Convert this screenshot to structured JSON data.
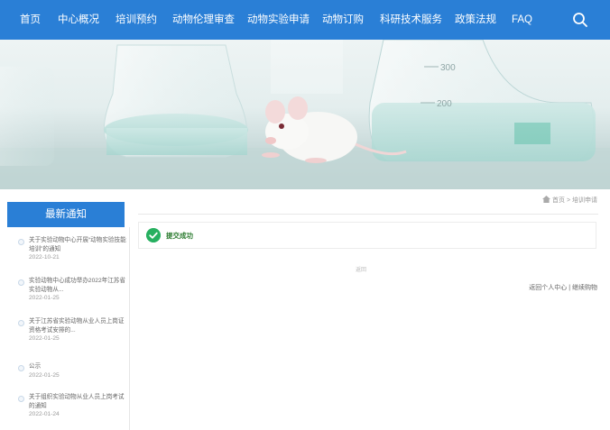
{
  "nav": {
    "items": [
      {
        "label": "首页"
      },
      {
        "label": "中心概况"
      },
      {
        "label": "培训预约"
      },
      {
        "label": "动物伦理审查"
      },
      {
        "label": "动物实验申请"
      },
      {
        "label": "动物订购"
      },
      {
        "label": "科研技术服务"
      },
      {
        "label": "政策法规"
      },
      {
        "label": "FAQ"
      }
    ],
    "search_icon": "search-icon"
  },
  "banner": {
    "flask_markings": [
      "300",
      "200"
    ]
  },
  "sidebar": {
    "title": "最新通知",
    "notices": [
      {
        "title": "关于实验动物中心开展“动物实验技能培训”的通知",
        "date": "2022-10-21"
      },
      {
        "title": "实验动物中心成功举办2022年江苏省实验动物从...",
        "date": "2022-01-25"
      },
      {
        "title": "关于江苏省实验动物从业人员上岗证资格考试安排的...",
        "date": "2022-01-25"
      },
      {
        "title": "公示",
        "date": "2022-01-25"
      },
      {
        "title": "关于组织实验动物从业人员上岗考试的通知",
        "date": "2022-01-24"
      }
    ]
  },
  "breadcrumb": {
    "home": "首页",
    "separator": ">",
    "current": "培训申请"
  },
  "result": {
    "message": "提交成功"
  },
  "center_note": "返回",
  "return_links": {
    "personal": "返回个人中心",
    "divider": "|",
    "continue": "继续购物"
  },
  "colors": {
    "nav_bg": "#2a7fd6",
    "success": "#27b060"
  }
}
